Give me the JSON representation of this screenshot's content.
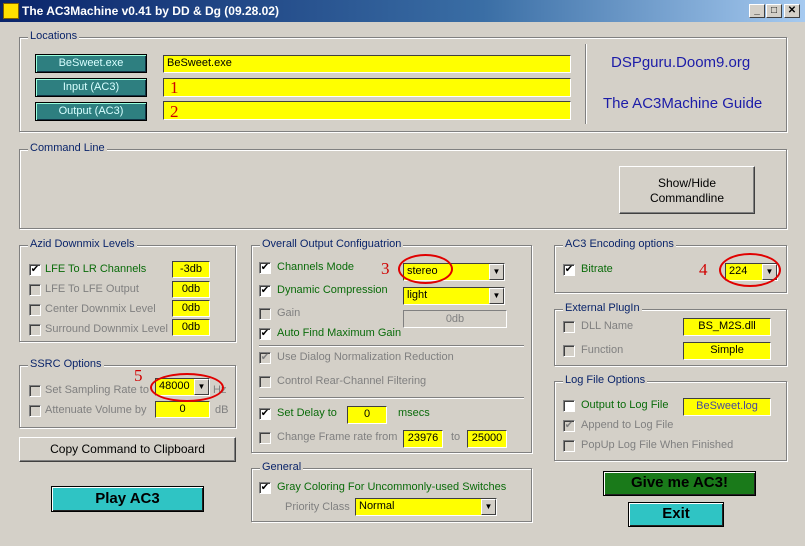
{
  "window": {
    "title": "The AC3Machine v0.41 by DD & Dg (09.28.02)",
    "controls": {
      "minimize": "_",
      "maximize": "□",
      "close": "✕"
    }
  },
  "locations": {
    "legend": "Locations",
    "besweet_btn": "BeSweet.exe",
    "besweet_value": "BeSweet.exe",
    "input_btn": "Input (AC3)",
    "input_value": "",
    "output_btn": "Output (AC3)",
    "output_value": "",
    "link_site": "DSPguru.Doom9.org",
    "link_guide": "The AC3Machine Guide"
  },
  "command_line": {
    "legend": "Command Line",
    "toggle_label": "Show/Hide\nCommandline"
  },
  "azid": {
    "legend": "Azid Downmix Levels",
    "items": [
      {
        "label": "LFE To LR Channels",
        "value": "-3db",
        "checked": true
      },
      {
        "label": "LFE To LFE Output",
        "value": "0db",
        "checked": false
      },
      {
        "label": "Center Downmix Level",
        "value": "0db",
        "checked": false
      },
      {
        "label": "Surround Downmix Level",
        "value": "0db",
        "checked": false
      }
    ]
  },
  "ssrc": {
    "legend": "SSRC Options",
    "rate_label": "Set Sampling Rate to",
    "rate_value": "48000",
    "rate_unit": "Hz",
    "atten_label": "Attenuate Volume by",
    "atten_value": "0",
    "atten_unit": "dB"
  },
  "copy_button": "Copy Command to Clipboard",
  "play_button": "Play AC3",
  "overall": {
    "legend": "Overall Output Configuatrion",
    "channels_label": "Channels Mode",
    "channels_value": "stereo",
    "dynamic_label": "Dynamic Compression",
    "dynamic_value": "light",
    "gain_label": "Gain",
    "gain_value": "0db",
    "autofind_label": "Auto Find Maximum Gain",
    "dialog_label": "Use Dialog Normalization Reduction",
    "rear_label": "Control Rear-Channel Filtering",
    "delay_label": "Set Delay to",
    "delay_value": "0",
    "delay_unit": "msecs",
    "frame_label": "Change Frame rate from",
    "frame_from": "23976",
    "frame_to_label": "to",
    "frame_to": "25000"
  },
  "general": {
    "legend": "General",
    "gray_label": "Gray Coloring For Uncommonly-used Switches",
    "priority_label": "Priority Class",
    "priority_value": "Normal"
  },
  "ac3_enc": {
    "legend": "AC3 Encoding options",
    "bitrate_label": "Bitrate",
    "bitrate_value": "224"
  },
  "plugin": {
    "legend": "External PlugIn",
    "dll_label": "DLL Name",
    "dll_value": "BS_M2S.dll",
    "function_label": "Function",
    "function_value": "Simple"
  },
  "logfile": {
    "legend": "Log File Options",
    "output_label": "Output to Log File",
    "output_value": "BeSweet.log",
    "append_label": "Append to Log File",
    "popup_label": "PopUp Log File When Finished"
  },
  "give_button": "Give me AC3!",
  "exit_button": "Exit",
  "annotations": [
    "1",
    "2",
    "3",
    "4",
    "5"
  ],
  "colors": {
    "title_bar": "#0a246a",
    "teal_button": "#2e7f80",
    "green_button": "#006400",
    "field_yellow": "#ffff00",
    "annotation_red": "#e00000"
  }
}
